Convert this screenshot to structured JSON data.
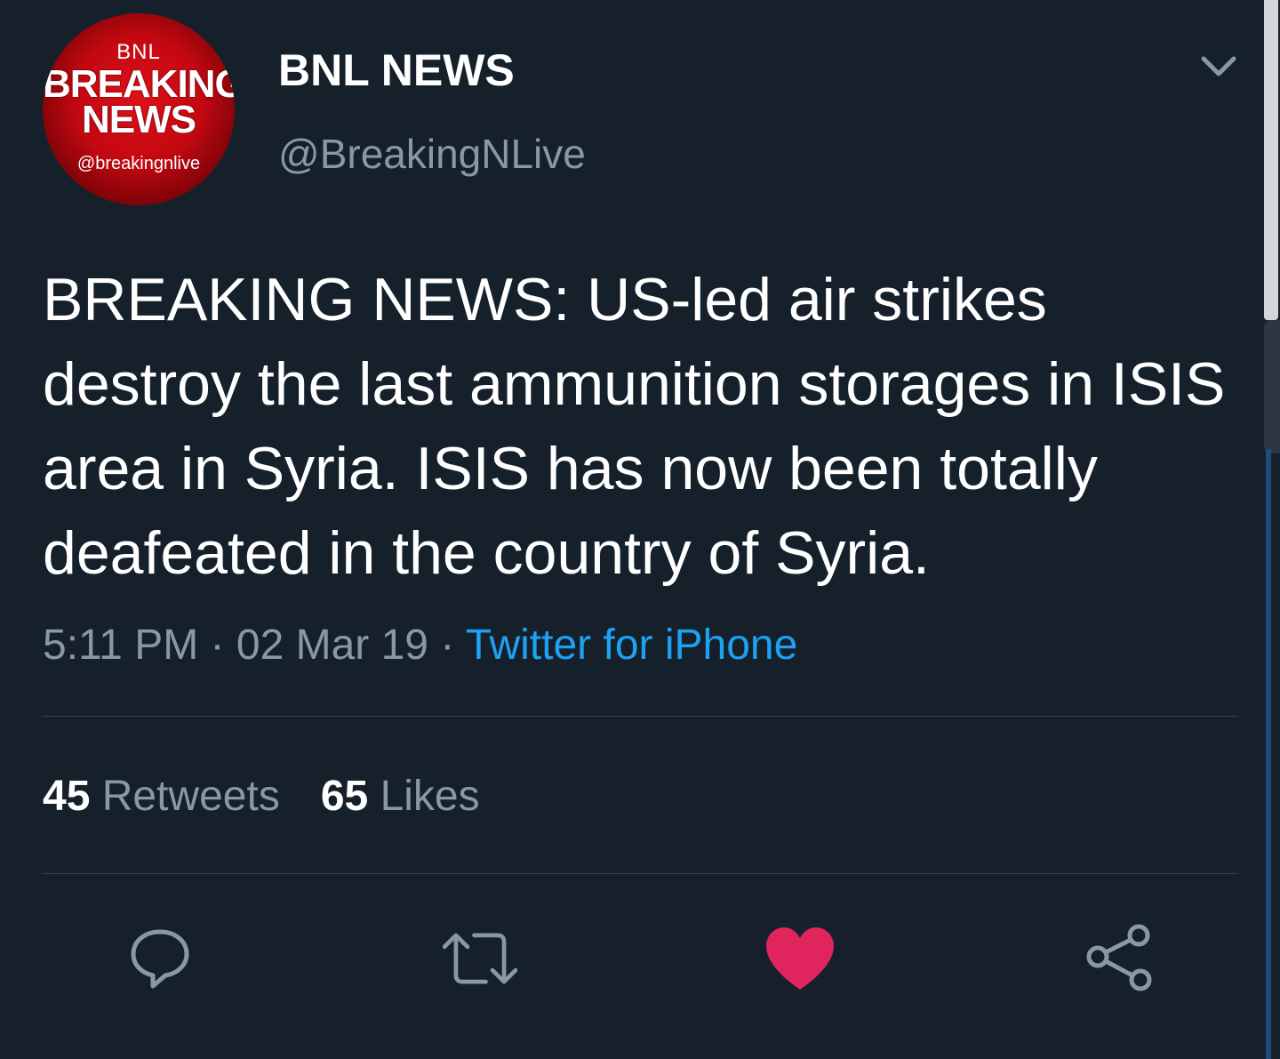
{
  "tweet": {
    "avatar": {
      "line1": "BNL",
      "line2": "BREAKING",
      "line3": "NEWS",
      "line4": "@breakingnlive",
      "colors": {
        "primary": "#e0101a",
        "dark": "#2a0002"
      }
    },
    "display_name": "BNL NEWS",
    "username": "@BreakingNLive",
    "menu_icon": "chevron-down-icon",
    "text": "BREAKING NEWS: US-led air strikes destroy the last ammunition storages in ISIS area in Syria. ISIS has now been totally deafeated in the country of Syria.",
    "time": "5:11 PM",
    "separator": "·",
    "date": "02 Mar 19",
    "source": "Twitter for iPhone",
    "retweets_count": "45",
    "retweets_label": "Retweets",
    "likes_count": "65",
    "likes_label": "Likes"
  },
  "actions": [
    {
      "name": "reply",
      "icon": "reply-icon"
    },
    {
      "name": "retweet",
      "icon": "retweet-icon"
    },
    {
      "name": "like",
      "icon": "heart-icon",
      "active": true
    },
    {
      "name": "share",
      "icon": "share-icon"
    }
  ],
  "colors": {
    "background": "#15202b",
    "text": "#ffffff",
    "muted": "#8899a6",
    "link": "#1da1f2",
    "like_active": "#e0245e",
    "divider": "#38444d"
  }
}
